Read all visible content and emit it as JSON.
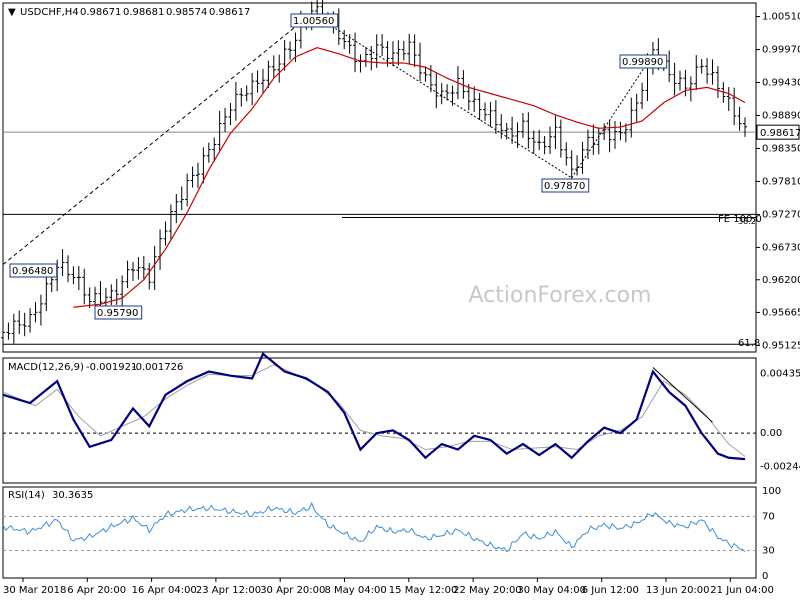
{
  "header": {
    "symbol_line": "USDCHF,H4",
    "o": "0.98671",
    "h": "0.98681",
    "l": "0.98574",
    "c": "0.98617",
    "arrow": "▼"
  },
  "watermark": "ActionForex.com",
  "colors": {
    "candle": "#000000",
    "ma": "#cc0000",
    "macd_main": "#000080",
    "macd_signal": "#a0a0a0",
    "rsi": "#3b8fd8",
    "hline": "#000000",
    "price_box_bg": "#ffffff"
  },
  "price_axis": {
    "ticks": [
      "1.00510",
      "0.99970",
      "0.99430",
      "0.98890",
      "0.98350",
      "0.97810",
      "0.97270",
      "0.96730",
      "0.96200",
      "0.95665",
      "0.95125"
    ],
    "current": "0.98617"
  },
  "macd_axis": {
    "ticks": [
      "0.004351",
      "0.00",
      "-0.002448"
    ]
  },
  "rsi_axis": {
    "ticks": [
      "100",
      "70",
      "30",
      "0"
    ]
  },
  "macd_label": {
    "name": "MACD(12,26,9)",
    "main": "-0.001921",
    "signal": "-0.001726"
  },
  "rsi_label": {
    "name": "RSI(14)",
    "value": "30.3635"
  },
  "x_axis": {
    "labels": [
      "30 Mar 2018",
      "6 Apr 20:00",
      "16 Apr 04:00",
      "23 Apr 12:00",
      "30 Apr 20:00",
      "8 May 04:00",
      "15 May 12:00",
      "22 May 20:00",
      "30 May 04:00",
      "6 Jun 12:00",
      "13 Jun 20:00",
      "21 Jun 04:00"
    ]
  },
  "annotations": {
    "high1": "1.00560",
    "high2": "0.99890",
    "low1": "0.97870",
    "low2": "0.96480",
    "low3": "0.95790",
    "fe_label": "FE 100.0",
    "fib1": "38.2",
    "fib2": "61.8"
  },
  "chart_data": {
    "type": "candlestick",
    "title": "USDCHF,H4",
    "x_labels": [
      "30 Mar 2018",
      "6 Apr 20:00",
      "16 Apr 04:00",
      "23 Apr 12:00",
      "30 Apr 20:00",
      "8 May 04:00",
      "15 May 12:00",
      "22 May 20:00",
      "30 May 04:00",
      "6 Jun 12:00",
      "13 Jun 20:00",
      "21 Jun 04:00"
    ],
    "ylim": [
      0.9505,
      1.0065
    ],
    "price_path": [
      [
        0,
        0.9525
      ],
      [
        5,
        0.956
      ],
      [
        10,
        0.9648
      ],
      [
        13,
        0.962
      ],
      [
        16,
        0.9579
      ],
      [
        20,
        0.96
      ],
      [
        24,
        0.965
      ],
      [
        27,
        0.962
      ],
      [
        30,
        0.97
      ],
      [
        34,
        0.978
      ],
      [
        38,
        0.984
      ],
      [
        42,
        0.99
      ],
      [
        46,
        0.993
      ],
      [
        50,
        0.9975
      ],
      [
        54,
        1.002
      ],
      [
        57,
        1.0056
      ],
      [
        60,
        1.004
      ],
      [
        63,
        1.001
      ],
      [
        66,
        0.9985
      ],
      [
        69,
        1.0005
      ],
      [
        72,
        0.998
      ],
      [
        75,
        0.9995
      ],
      [
        78,
        0.995
      ],
      [
        81,
        0.993
      ],
      [
        84,
        0.9945
      ],
      [
        87,
        0.99
      ],
      [
        90,
        0.988
      ],
      [
        93,
        0.986
      ],
      [
        96,
        0.988
      ],
      [
        99,
        0.984
      ],
      [
        102,
        0.9855
      ],
      [
        105,
        0.9787
      ],
      [
        108,
        0.985
      ],
      [
        111,
        0.987
      ],
      [
        114,
        0.986
      ],
      [
        117,
        0.99
      ],
      [
        120,
        0.9989
      ],
      [
        123,
        0.996
      ],
      [
        126,
        0.9945
      ],
      [
        129,
        0.9975
      ],
      [
        132,
        0.993
      ],
      [
        134,
        0.99
      ],
      [
        137,
        0.9862
      ]
    ],
    "ma_path": [
      [
        13,
        0.9575
      ],
      [
        18,
        0.958
      ],
      [
        22,
        0.959
      ],
      [
        26,
        0.962
      ],
      [
        30,
        0.967
      ],
      [
        34,
        0.973
      ],
      [
        38,
        0.98
      ],
      [
        42,
        0.986
      ],
      [
        46,
        0.99
      ],
      [
        50,
        0.995
      ],
      [
        54,
        0.9985
      ],
      [
        58,
        1.0
      ],
      [
        62,
        0.999
      ],
      [
        66,
        0.9978
      ],
      [
        70,
        0.9975
      ],
      [
        74,
        0.9975
      ],
      [
        78,
        0.9968
      ],
      [
        82,
        0.995
      ],
      [
        86,
        0.9935
      ],
      [
        90,
        0.9925
      ],
      [
        94,
        0.9915
      ],
      [
        98,
        0.9905
      ],
      [
        102,
        0.989
      ],
      [
        106,
        0.9878
      ],
      [
        110,
        0.9868
      ],
      [
        114,
        0.987
      ],
      [
        118,
        0.988
      ],
      [
        122,
        0.991
      ],
      [
        126,
        0.993
      ],
      [
        130,
        0.9935
      ],
      [
        134,
        0.9925
      ],
      [
        137,
        0.991
      ]
    ],
    "trend_lines": [
      {
        "from": [
          0,
          0.9645
        ],
        "to": [
          57,
          1.0056
        ],
        "style": "dashed"
      },
      {
        "from": [
          57,
          1.0056
        ],
        "to": [
          105,
          0.9787
        ],
        "style": "dotted"
      },
      {
        "from": [
          105,
          0.9787
        ],
        "to": [
          120,
          0.9989
        ],
        "style": "dotted"
      }
    ],
    "horizontal_levels": [
      {
        "value": 0.98617,
        "label": ""
      },
      {
        "value": 0.9727,
        "label": "38.2"
      },
      {
        "value": 0.95145,
        "label": "61.8"
      }
    ],
    "macd": {
      "ylim": [
        -0.0035,
        0.0052
      ],
      "main_path": [
        [
          0,
          0.0028
        ],
        [
          5,
          0.0022
        ],
        [
          10,
          0.0038
        ],
        [
          13,
          0.001
        ],
        [
          16,
          -0.001
        ],
        [
          20,
          -0.0005
        ],
        [
          24,
          0.0018
        ],
        [
          27,
          0.0005
        ],
        [
          30,
          0.0028
        ],
        [
          34,
          0.0038
        ],
        [
          38,
          0.0045
        ],
        [
          42,
          0.0042
        ],
        [
          46,
          0.004
        ],
        [
          48,
          0.0058
        ],
        [
          52,
          0.0045
        ],
        [
          56,
          0.004
        ],
        [
          60,
          0.003
        ],
        [
          63,
          0.0015
        ],
        [
          66,
          -0.0012
        ],
        [
          69,
          0.0
        ],
        [
          72,
          0.0002
        ],
        [
          75,
          -0.0005
        ],
        [
          78,
          -0.0018
        ],
        [
          81,
          -0.0008
        ],
        [
          84,
          -0.0012
        ],
        [
          87,
          -0.0002
        ],
        [
          90,
          -0.0005
        ],
        [
          93,
          -0.0015
        ],
        [
          96,
          -0.0008
        ],
        [
          99,
          -0.0016
        ],
        [
          102,
          -0.0008
        ],
        [
          105,
          -0.0018
        ],
        [
          108,
          -0.0006
        ],
        [
          111,
          0.0004
        ],
        [
          114,
          0.0
        ],
        [
          117,
          0.001
        ],
        [
          120,
          0.0045
        ],
        [
          123,
          0.003
        ],
        [
          126,
          0.002
        ],
        [
          129,
          0.0
        ],
        [
          132,
          -0.0015
        ],
        [
          134,
          -0.0018
        ],
        [
          137,
          -0.0019
        ]
      ],
      "signal_path": [
        [
          0,
          0.003
        ],
        [
          6,
          0.002
        ],
        [
          10,
          0.0032
        ],
        [
          14,
          0.0012
        ],
        [
          18,
          -0.0002
        ],
        [
          22,
          0.0005
        ],
        [
          26,
          0.0012
        ],
        [
          30,
          0.0025
        ],
        [
          34,
          0.0035
        ],
        [
          38,
          0.0043
        ],
        [
          42,
          0.0042
        ],
        [
          46,
          0.0042
        ],
        [
          50,
          0.005
        ],
        [
          54,
          0.0043
        ],
        [
          58,
          0.0035
        ],
        [
          62,
          0.0022
        ],
        [
          66,
          0.0002
        ],
        [
          70,
          -0.0002
        ],
        [
          74,
          -0.0004
        ],
        [
          78,
          -0.0012
        ],
        [
          82,
          -0.001
        ],
        [
          86,
          -0.0006
        ],
        [
          90,
          -0.0006
        ],
        [
          94,
          -0.0012
        ],
        [
          98,
          -0.0011
        ],
        [
          102,
          -0.001
        ],
        [
          106,
          -0.0012
        ],
        [
          110,
          -0.0002
        ],
        [
          114,
          0.0002
        ],
        [
          118,
          0.0012
        ],
        [
          122,
          0.0038
        ],
        [
          126,
          0.0028
        ],
        [
          130,
          0.0012
        ],
        [
          134,
          -0.0008
        ],
        [
          137,
          -0.0017
        ]
      ]
    },
    "rsi": {
      "ylim": [
        0,
        100
      ],
      "levels": [
        70,
        30
      ],
      "path": [
        [
          0,
          58
        ],
        [
          5,
          52
        ],
        [
          10,
          66
        ],
        [
          13,
          42
        ],
        [
          16,
          46
        ],
        [
          20,
          58
        ],
        [
          24,
          68
        ],
        [
          27,
          54
        ],
        [
          30,
          72
        ],
        [
          34,
          78
        ],
        [
          38,
          80
        ],
        [
          42,
          76
        ],
        [
          46,
          72
        ],
        [
          50,
          80
        ],
        [
          54,
          74
        ],
        [
          57,
          82
        ],
        [
          60,
          60
        ],
        [
          63,
          50
        ],
        [
          66,
          40
        ],
        [
          69,
          58
        ],
        [
          72,
          52
        ],
        [
          75,
          54
        ],
        [
          78,
          44
        ],
        [
          81,
          48
        ],
        [
          84,
          54
        ],
        [
          87,
          44
        ],
        [
          90,
          36
        ],
        [
          93,
          30
        ],
        [
          96,
          50
        ],
        [
          99,
          44
        ],
        [
          102,
          52
        ],
        [
          105,
          34
        ],
        [
          108,
          54
        ],
        [
          111,
          60
        ],
        [
          114,
          56
        ],
        [
          117,
          62
        ],
        [
          120,
          74
        ],
        [
          123,
          62
        ],
        [
          126,
          58
        ],
        [
          129,
          66
        ],
        [
          132,
          46
        ],
        [
          134,
          38
        ],
        [
          137,
          30.36
        ]
      ]
    }
  }
}
